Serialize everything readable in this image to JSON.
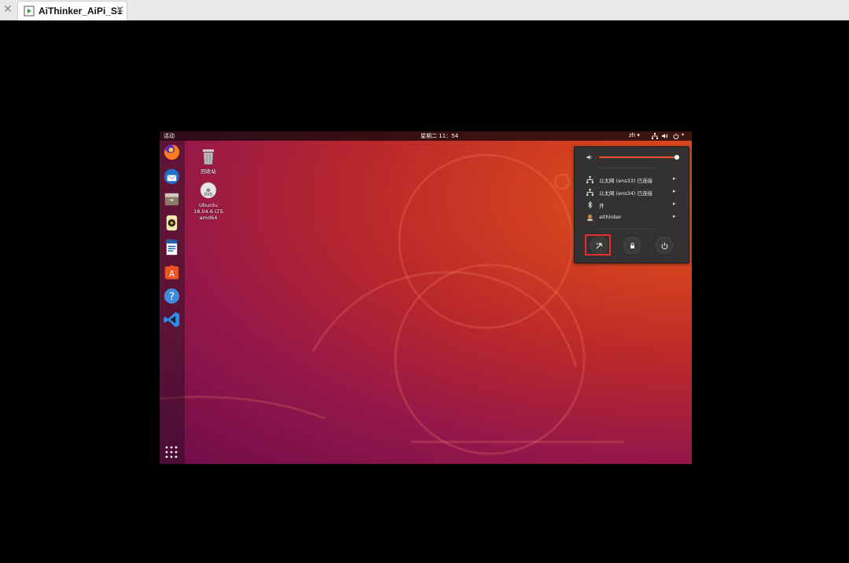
{
  "window_tab": {
    "title": "AiThinker_AiPi_S1",
    "close_symbol": "✕"
  },
  "topbar": {
    "activities": "活动",
    "clock": "星期二 11：54",
    "lang": "zh ▾"
  },
  "dock_items": [
    "firefox-icon",
    "thunderbird-icon",
    "files-icon",
    "rhythmbox-icon",
    "libreoffice-writer-icon",
    "software-center-icon",
    "help-icon",
    "vscode-icon"
  ],
  "desktop_icons": {
    "trash_label": "回收站",
    "dvd_line1": "Ubuntu",
    "dvd_line2": "18.04.6 LTS",
    "dvd_line3": "amd64"
  },
  "system_menu": {
    "volume_level": 1.0,
    "ethernet1": "以太网 (ens33) 已连接",
    "ethernet2": "以太网 (ens34) 已连接",
    "bluetooth": "开",
    "user": "aithinker"
  },
  "colors": {
    "accent": "#e95420",
    "highlight_box": "#e03030"
  }
}
